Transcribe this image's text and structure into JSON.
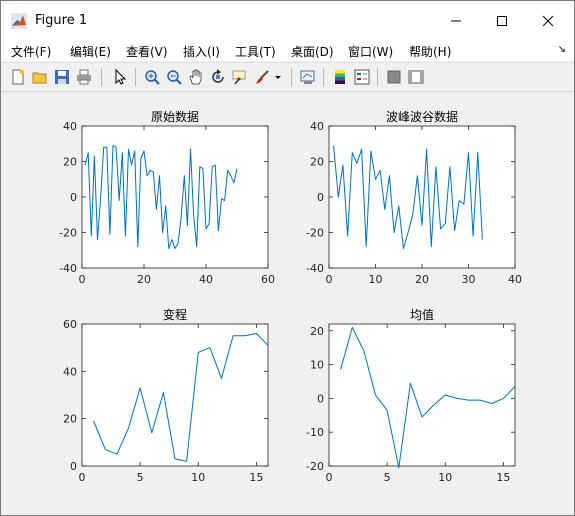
{
  "window": {
    "title": "Figure 1"
  },
  "menu": [
    "文件(F)",
    "编辑(E)",
    "查看(V)",
    "插入(I)",
    "工具(T)",
    "桌面(D)",
    "窗口(W)",
    "帮助(H)"
  ],
  "toolbar": [
    "new-figure",
    "open-file",
    "save",
    "print",
    "edit-plot",
    "zoom-in",
    "zoom-out",
    "pan",
    "rotate-3d",
    "data-cursor",
    "brush",
    "link-plot",
    "insert-colorbar",
    "insert-legend",
    "hide-plot-tools",
    "show-plot-tools"
  ],
  "chart_data": [
    {
      "type": "line",
      "title": "原始数据",
      "xlim": [
        0,
        60
      ],
      "ylim": [
        -40,
        40
      ],
      "xticks": [
        0,
        20,
        40,
        60
      ],
      "yticks": [
        -40,
        -20,
        0,
        20,
        40
      ],
      "x": [
        1,
        2,
        3,
        4,
        5,
        6,
        7,
        8,
        9,
        10,
        11,
        12,
        13,
        14,
        15,
        16,
        17,
        18,
        19,
        20,
        21,
        22,
        23,
        24,
        25,
        26,
        27,
        28,
        29,
        30,
        31,
        32,
        33,
        34,
        35,
        36,
        37,
        38,
        39,
        40,
        41,
        42,
        43,
        44,
        45,
        46,
        47,
        48,
        49,
        50
      ],
      "y": [
        18,
        25,
        -22,
        23,
        -24,
        -1,
        28,
        28,
        -21,
        29,
        28,
        -2,
        25,
        -22,
        27,
        18,
        26,
        -28,
        22,
        26,
        12,
        15,
        14,
        -7,
        12,
        -20,
        -5,
        -29,
        -24,
        -29,
        -26,
        -11,
        12,
        -16,
        27,
        -10,
        -28,
        17,
        16,
        -18,
        -15,
        17,
        18,
        -19,
        -1,
        -2,
        15,
        12,
        8,
        16
      ]
    },
    {
      "type": "line",
      "title": "波峰波谷数据",
      "xlim": [
        0,
        40
      ],
      "ylim": [
        -40,
        40
      ],
      "xticks": [
        0,
        10,
        20,
        30,
        40
      ],
      "yticks": [
        -40,
        -20,
        0,
        20,
        40
      ],
      "x": [
        1,
        2,
        3,
        4,
        5,
        6,
        7,
        8,
        9,
        10,
        11,
        12,
        13,
        14,
        15,
        16,
        17,
        18,
        19,
        20,
        21,
        22,
        23,
        24,
        25,
        26,
        27,
        28,
        29,
        30,
        31,
        32,
        33
      ],
      "y": [
        29,
        0,
        18,
        -22,
        25,
        19,
        27,
        -28,
        26,
        10,
        15,
        -7,
        12,
        -20,
        -5,
        -29,
        -20,
        -10,
        12,
        -16,
        27,
        -28,
        17,
        -18,
        -15,
        17,
        -19,
        -2,
        -4,
        25,
        -22,
        25,
        -24,
        29
      ]
    },
    {
      "type": "line",
      "title": "变程",
      "xlim": [
        0,
        16
      ],
      "ylim": [
        0,
        60
      ],
      "xticks": [
        0,
        5,
        10,
        15
      ],
      "yticks": [
        0,
        20,
        40,
        60
      ],
      "x": [
        1,
        2,
        3,
        4,
        5,
        6,
        7,
        8,
        9,
        10,
        11,
        12,
        13,
        14,
        15,
        16
      ],
      "y": [
        19,
        7,
        5,
        16,
        33,
        14,
        31,
        3,
        2,
        48,
        50,
        37,
        55,
        55,
        56,
        51
      ]
    },
    {
      "type": "line",
      "title": "均值",
      "xlim": [
        0,
        16
      ],
      "ylim": [
        -20,
        22
      ],
      "xticks": [
        0,
        5,
        10,
        15
      ],
      "yticks": [
        -20,
        -10,
        0,
        10,
        20
      ],
      "x": [
        1,
        2,
        3,
        4,
        5,
        6,
        7,
        8,
        9,
        10,
        11,
        12,
        13,
        14,
        15,
        16
      ],
      "y": [
        8.5,
        21,
        14,
        1,
        -3.5,
        -20.5,
        4.5,
        -5.5,
        -2,
        1,
        0,
        -0.5,
        -0.5,
        -1.5,
        0,
        3.5
      ]
    }
  ]
}
